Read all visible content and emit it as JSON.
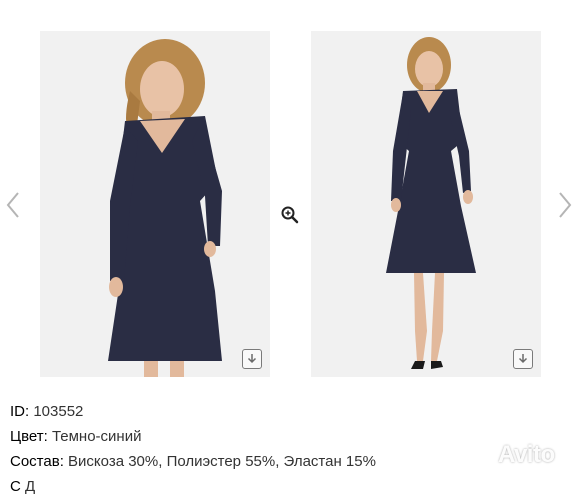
{
  "gallery": {
    "prev_icon": "chevron-left-icon",
    "next_icon": "chevron-right-icon",
    "zoom_icon": "zoom-in-icon",
    "download_icon": "download-icon",
    "dress_color": "#2a2d44",
    "background_color": "#f1f1f1"
  },
  "details": {
    "id_label": "ID:",
    "id_value": "103552",
    "color_label": "Цвет:",
    "color_value": "Темно-синий",
    "composition_label": "Состав:",
    "composition_value": "Вискоза 30%, Полиэстер 55%, Эластан 15%",
    "partial_label": "С",
    "partial_value": "Д"
  },
  "watermark": {
    "text": "Avito"
  }
}
